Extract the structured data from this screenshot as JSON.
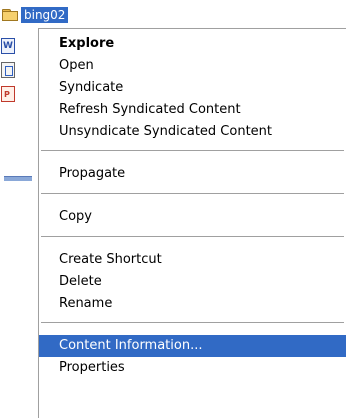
{
  "explorer": {
    "selected_item_name": "bing02",
    "icons": [
      "folder-icon",
      "word-document-icon",
      "web-document-icon",
      "powerpoint-document-icon"
    ]
  },
  "context_menu": {
    "groups": [
      [
        "Explore",
        "Open",
        "Syndicate",
        "Refresh Syndicated Content",
        "Unsyndicate Syndicated Content"
      ],
      [
        "Propagate"
      ],
      [
        "Copy"
      ],
      [
        "Create Shortcut",
        "Delete",
        "Rename"
      ],
      [
        "Content Information...",
        "Properties"
      ]
    ],
    "default_item": "Explore",
    "highlighted_item": "Content Information...",
    "highlight_color": "#316ac5"
  }
}
